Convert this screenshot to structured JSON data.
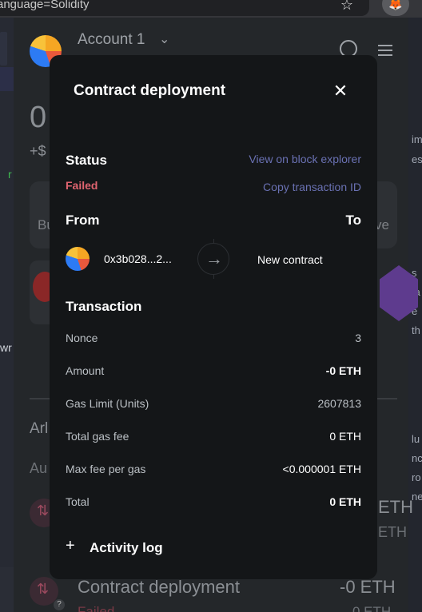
{
  "browser": {
    "url_fragment": "anguage=Solidity"
  },
  "background_wallet": {
    "account_name": "Account 1",
    "balance": "0",
    "fiat": "+$",
    "action_left": "Bu",
    "action_right": "ve",
    "network_partial": "Arl",
    "auto_partial": "Au",
    "eth_1": "ETH",
    "eth_2": "ETH",
    "last_tx_title": "Contract deployment",
    "last_tx_amount": "-0 ETH",
    "last_tx_status": "Failed",
    "last_tx_eth": "0 ETH"
  },
  "modal": {
    "title": "Contract deployment",
    "status_label": "Status",
    "status_value": "Failed",
    "view_explorer": "View on block explorer",
    "copy_tx_id": "Copy transaction ID",
    "from_label": "From",
    "to_label": "To",
    "from_address": "0x3b028...2...",
    "to_value": "New contract",
    "transaction_label": "Transaction",
    "rows": [
      {
        "key": "Nonce",
        "value": "3"
      },
      {
        "key": "Amount",
        "value": "-0 ETH"
      },
      {
        "key": "Gas Limit (Units)",
        "value": "2607813"
      },
      {
        "key": "Total gas fee",
        "value": "0 ETH"
      },
      {
        "key": "Max fee per gas",
        "value": "<0.000001 ETH"
      },
      {
        "key": "Total",
        "value": "0 ETH"
      }
    ],
    "activity_log": "Activity log"
  },
  "colors": {
    "modal_bg": "#141618",
    "failed": "#e06470",
    "link": "#6a71b3"
  }
}
